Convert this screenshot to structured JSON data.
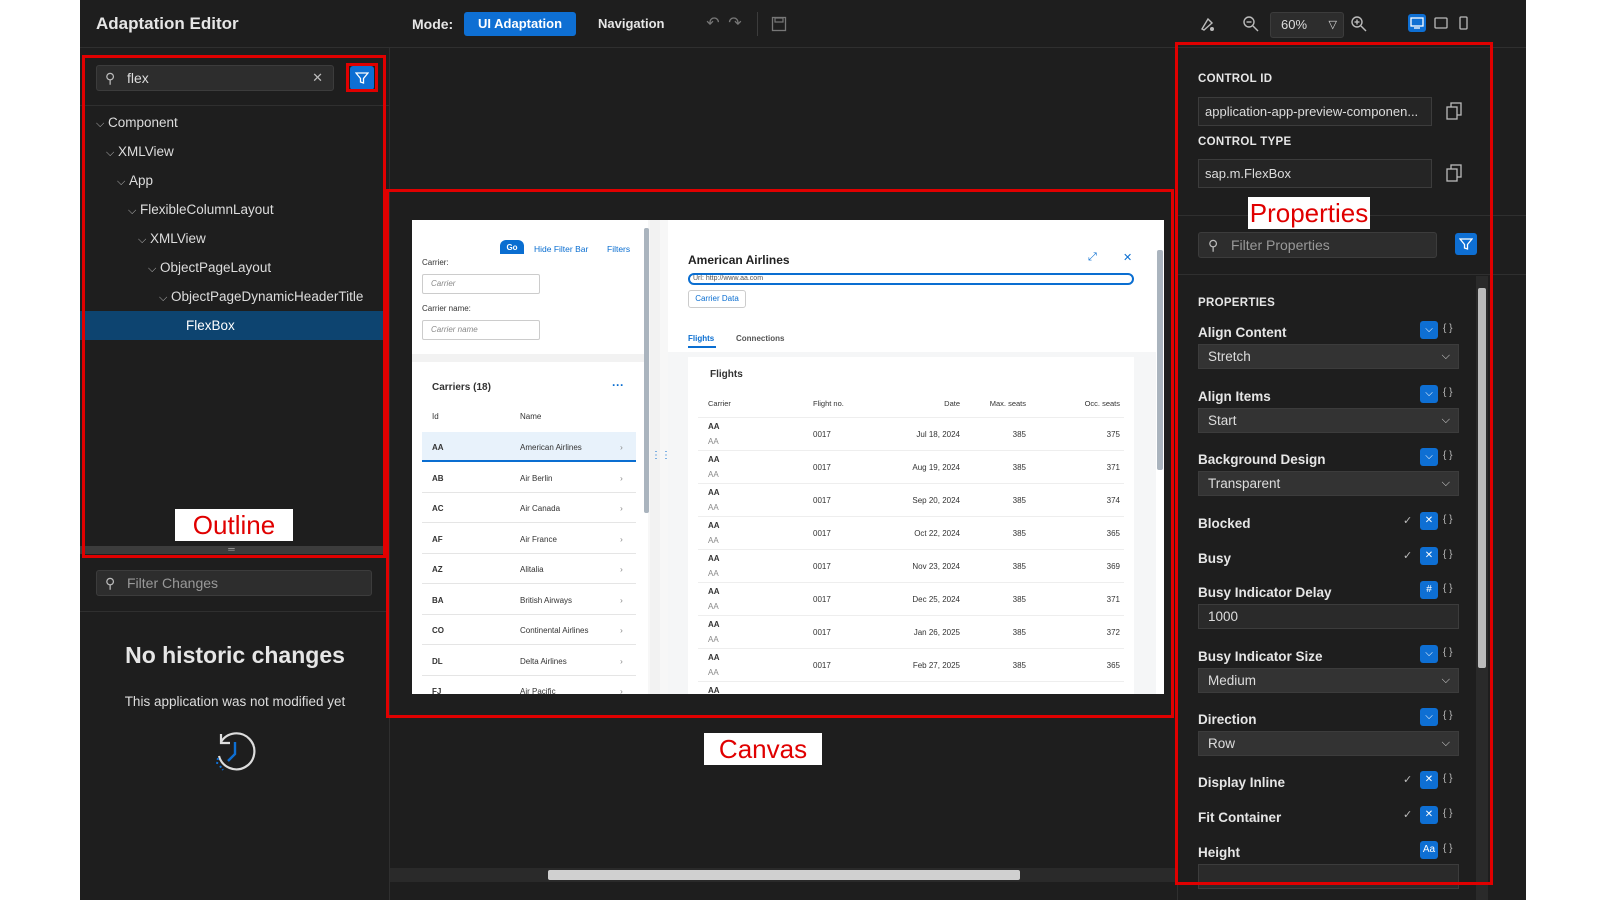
{
  "app_title": "Adaptation Editor",
  "toolbar": {
    "mode_label": "Mode:",
    "mode_ui_adaptation": "UI Adaptation",
    "mode_navigation": "Navigation",
    "zoom_value": "60%"
  },
  "outline": {
    "search_value": "flex",
    "tree": [
      {
        "label": "Component",
        "expanded": true,
        "selected": false
      },
      {
        "label": "XMLView",
        "expanded": true,
        "selected": false
      },
      {
        "label": "App",
        "expanded": true,
        "selected": false
      },
      {
        "label": "FlexibleColumnLayout",
        "expanded": true,
        "selected": false
      },
      {
        "label": "XMLView",
        "expanded": true,
        "selected": false
      },
      {
        "label": "ObjectPageLayout",
        "expanded": true,
        "selected": false
      },
      {
        "label": "ObjectPageDynamicHeaderTitle",
        "expanded": true,
        "selected": false
      },
      {
        "label": "FlexBox",
        "expanded": false,
        "selected": true
      }
    ]
  },
  "changes": {
    "filter_placeholder": "Filter Changes",
    "empty_title": "No historic changes",
    "empty_subtitle": "This application was not modified yet"
  },
  "properties_panel": {
    "control_id_label": "CONTROL ID",
    "control_id_value": "application-app-preview-componen...",
    "control_type_label": "CONTROL TYPE",
    "control_type_value": "sap.m.FlexBox",
    "filter_placeholder": "Filter Properties",
    "section_title": "PROPERTIES",
    "props": [
      {
        "name": "Align Content",
        "kind": "select",
        "value": "Stretch",
        "icon": "chevron-down-icon"
      },
      {
        "name": "Align Items",
        "kind": "select",
        "value": "Start",
        "icon": "chevron-down-icon"
      },
      {
        "name": "Background Design",
        "kind": "select",
        "value": "Transparent",
        "icon": "chevron-down-icon"
      },
      {
        "name": "Blocked",
        "kind": "bool",
        "icon": "close-icon"
      },
      {
        "name": "Busy",
        "kind": "bool",
        "icon": "close-icon"
      },
      {
        "name": "Busy Indicator Delay",
        "kind": "number",
        "value": "1000",
        "icon": "hash-icon"
      },
      {
        "name": "Busy Indicator Size",
        "kind": "select",
        "value": "Medium",
        "icon": "chevron-down-icon"
      },
      {
        "name": "Direction",
        "kind": "select",
        "value": "Row",
        "icon": "chevron-down-icon"
      },
      {
        "name": "Display Inline",
        "kind": "bool",
        "icon": "close-icon"
      },
      {
        "name": "Fit Container",
        "kind": "bool",
        "icon": "close-icon"
      },
      {
        "name": "Height",
        "kind": "text",
        "value": "",
        "icon": "text-icon"
      }
    ]
  },
  "annotations": {
    "outline": "Outline",
    "canvas": "Canvas",
    "properties": "Properties"
  },
  "preview": {
    "go": "Go",
    "hide_filter_bar": "Hide Filter Bar",
    "filters": "Filters",
    "carrier_label": "Carrier:",
    "carrier_placeholder": "Carrier",
    "carrier_name_label": "Carrier name:",
    "carrier_name_placeholder": "Carrier name",
    "carriers_title": "Carriers (18)",
    "col_id": "Id",
    "col_name": "Name",
    "carriers": [
      {
        "id": "AA",
        "name": "American Airlines"
      },
      {
        "id": "AB",
        "name": "Air Berlin"
      },
      {
        "id": "AC",
        "name": "Air Canada"
      },
      {
        "id": "AF",
        "name": "Air France"
      },
      {
        "id": "AZ",
        "name": "Alitalia"
      },
      {
        "id": "BA",
        "name": "British Airways"
      },
      {
        "id": "CO",
        "name": "Continental Airlines"
      },
      {
        "id": "DL",
        "name": "Delta Airlines"
      },
      {
        "id": "FJ",
        "name": "Air Pacific"
      }
    ],
    "object_title": "American Airlines",
    "url_text": "Url: http://www.aa.com",
    "carrier_data_btn": "Carrier Data",
    "tab_flights": "Flights",
    "tab_connections": "Connections",
    "flights_title": "Flights",
    "flight_cols": [
      "Carrier",
      "Flight no.",
      "Date",
      "Max. seats",
      "Occ. seats"
    ],
    "flights": [
      {
        "carrier": "AA",
        "sub": "AA",
        "no": "0017",
        "date": "Jul 18, 2024",
        "max": "385",
        "occ": "375"
      },
      {
        "carrier": "AA",
        "sub": "AA",
        "no": "0017",
        "date": "Aug 19, 2024",
        "max": "385",
        "occ": "371"
      },
      {
        "carrier": "AA",
        "sub": "AA",
        "no": "0017",
        "date": "Sep 20, 2024",
        "max": "385",
        "occ": "374"
      },
      {
        "carrier": "AA",
        "sub": "AA",
        "no": "0017",
        "date": "Oct 22, 2024",
        "max": "385",
        "occ": "365"
      },
      {
        "carrier": "AA",
        "sub": "AA",
        "no": "0017",
        "date": "Nov 23, 2024",
        "max": "385",
        "occ": "369"
      },
      {
        "carrier": "AA",
        "sub": "AA",
        "no": "0017",
        "date": "Dec 25, 2024",
        "max": "385",
        "occ": "371"
      },
      {
        "carrier": "AA",
        "sub": "AA",
        "no": "0017",
        "date": "Jan 26, 2025",
        "max": "385",
        "occ": "372"
      },
      {
        "carrier": "AA",
        "sub": "AA",
        "no": "0017",
        "date": "Feb 27, 2025",
        "max": "385",
        "occ": "365"
      },
      {
        "carrier": "AA",
        "sub": "",
        "no": "",
        "date": "",
        "max": "",
        "occ": ""
      }
    ]
  },
  "colors": {
    "accent": "#0e6fd3",
    "annotation": "#e00000",
    "background": "#1e1e1e",
    "selection": "#0d4470"
  }
}
